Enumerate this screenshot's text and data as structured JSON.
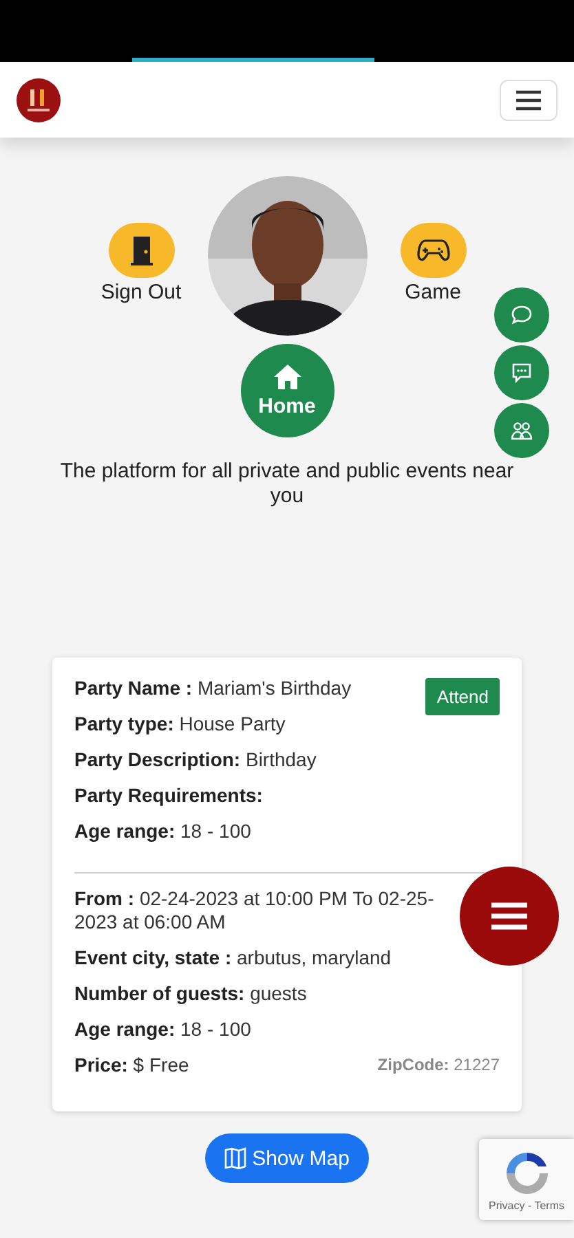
{
  "hero": {
    "actions": [
      {
        "kind": "signout",
        "label": "Sign Out"
      },
      {
        "kind": "game",
        "label": "Game"
      }
    ],
    "home": {
      "label": "Home"
    },
    "tagline": "The platform for all private and public events near you"
  },
  "side_buttons": [
    {
      "kind": "chat"
    },
    {
      "kind": "message"
    },
    {
      "kind": "people"
    }
  ],
  "party": {
    "attend": "Attend",
    "top_rows": [
      {
        "label": "Party Name :",
        "value": "Mariam's Birthday"
      },
      {
        "label": "Party type:",
        "value": "House Party"
      },
      {
        "label": "Party Description:",
        "value": "Birthday"
      },
      {
        "label": "Party Requirements:",
        "value": ""
      },
      {
        "label": "Age range:",
        "value": "18 - 100"
      }
    ],
    "bottom_rows": [
      {
        "label": "From :",
        "value": "02-24-2023 at 10:00 PM To 02-25-2023 at 06:00 AM"
      },
      {
        "label": "Event city, state :",
        "value": "arbutus, maryland"
      },
      {
        "label": "Number of guests:",
        "value": "guests"
      },
      {
        "label": "Age range:",
        "value": "18 - 100"
      },
      {
        "label": "Price:",
        "value": "$ Free"
      }
    ],
    "zip": {
      "label": "ZipCode:",
      "value": "21227"
    }
  },
  "show_map": "Show Map",
  "recaptcha": {
    "links": "Privacy - Terms"
  }
}
